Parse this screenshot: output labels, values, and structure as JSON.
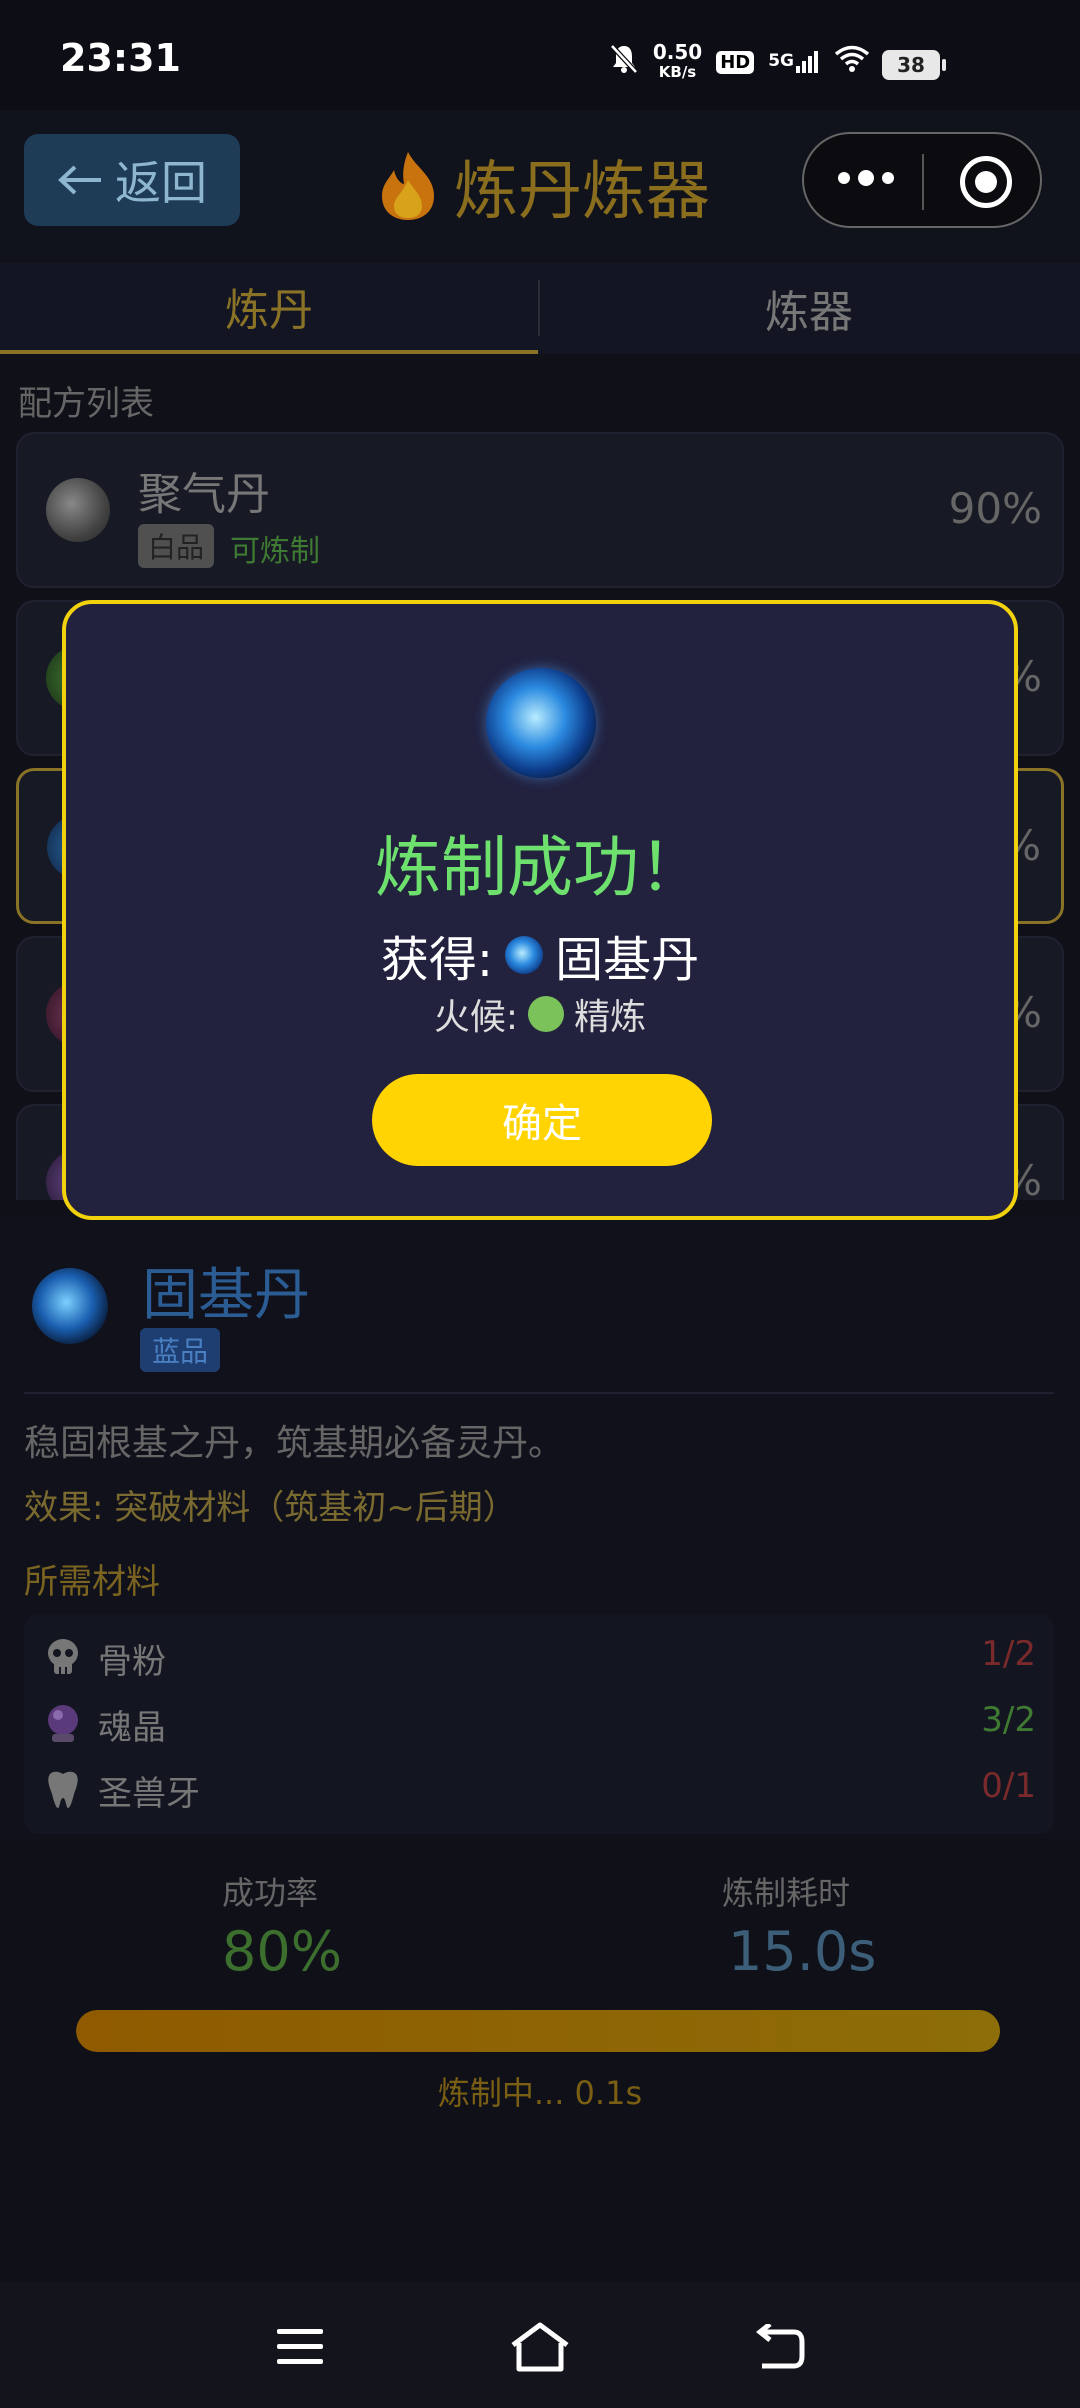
{
  "status_bar": {
    "time": "23:31",
    "net_speed": "0.50",
    "net_unit": "KB/s",
    "hd": "HD",
    "network": "5G",
    "battery": "38"
  },
  "header": {
    "back_label": "返回",
    "title": "炼丹炼器"
  },
  "tabs": [
    {
      "label": "炼丹",
      "active": true
    },
    {
      "label": "炼器",
      "active": false
    }
  ],
  "section_label": "配方列表",
  "recipes": [
    {
      "name": "聚气丹",
      "grade": "白品",
      "status": "可炼制",
      "rate": "90%"
    },
    {
      "rate": "%"
    },
    {
      "rate": "%"
    },
    {
      "rate": "%"
    },
    {
      "rate": "%"
    }
  ],
  "modal": {
    "title": "炼制成功！",
    "obtain_label": "获得:",
    "item_name": "固基丹",
    "fire_label": "火候:",
    "fire_level": "精炼",
    "confirm_label": "确定"
  },
  "detail": {
    "name": "固基丹",
    "grade": "蓝品",
    "description": "稳固根基之丹，筑基期必备灵丹。",
    "effect": "效果: 突破材料（筑基初~后期）",
    "materials_title": "所需材料",
    "materials": [
      {
        "name": "骨粉",
        "count": "1/2",
        "icon": "skull-icon",
        "enough": false
      },
      {
        "name": "魂晶",
        "count": "3/2",
        "icon": "crystal-ball-icon",
        "enough": true
      },
      {
        "name": "圣兽牙",
        "count": "0/1",
        "icon": "tooth-icon",
        "enough": false
      }
    ]
  },
  "stats": {
    "success_label": "成功率",
    "success_value": "80%",
    "time_label": "炼制耗时",
    "time_value": "15.0s"
  },
  "progress": {
    "fraction": 1.0,
    "text": "炼制中... 0.1s"
  },
  "colors": {
    "accent_gold": "#ffd400",
    "success_green": "#6ee06e",
    "modal_bg": "#22223f"
  }
}
